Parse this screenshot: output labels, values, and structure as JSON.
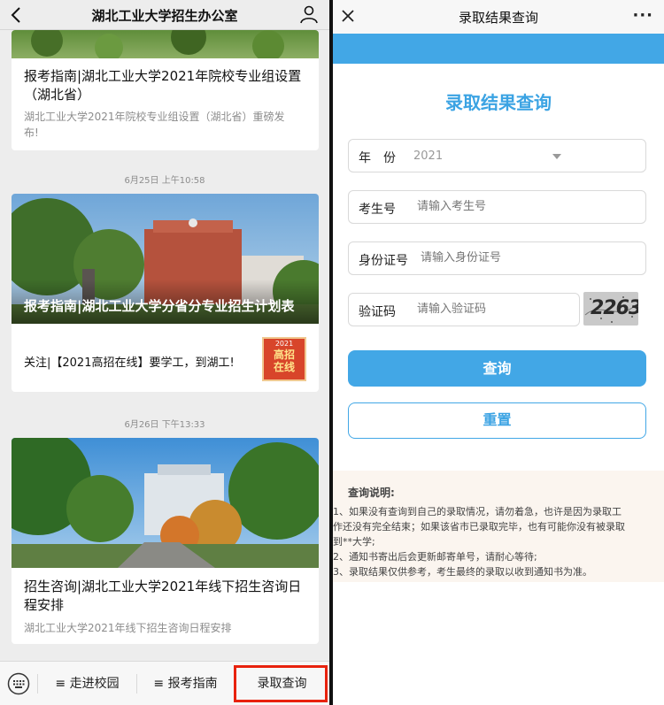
{
  "left": {
    "header": {
      "title": "湖北工业大学招生办公室",
      "back_icon": "chevron-left-icon",
      "user_icon": "user-icon"
    },
    "article1": {
      "title_line1": "报考指南|湖北工业大学2021年院校专业组设置",
      "title_line2": "（湖北省）",
      "desc_line1": "湖北工业大学2021年院校专业组设置（湖北省）重磅发",
      "desc_line2": "布!"
    },
    "timestamp1": "6月25日 上午10:58",
    "article2": {
      "hero_title": "报考指南|湖北工业大学分省分专业招生计划表",
      "sub_text": "关注|【2021高招在线】要学工，到湖工!",
      "thumb_line1": "2021",
      "thumb_line2": "高招",
      "thumb_line3": "在线"
    },
    "timestamp2": "6月26日 下午13:33",
    "article3": {
      "title_line1": "招生咨询|湖北工业大学2021年线下招生咨询日",
      "title_line2": "程安排",
      "desc": "湖北工业大学2021年线下招生咨询日程安排"
    },
    "footer": {
      "keyboard_icon": "keyboard-icon",
      "menu": [
        "≡ 走进校园",
        "≡ 报考指南",
        "录取查询"
      ]
    }
  },
  "right": {
    "header": {
      "title": "录取结果查询",
      "close_icon": "close-icon",
      "more": "···"
    },
    "form": {
      "title": "录取结果查询",
      "year_label": "年　份",
      "year_value": "2021",
      "exam_label": "考生号",
      "exam_placeholder": "请输入考生号",
      "id_label": "身份证号",
      "id_placeholder": "请输入身份证号",
      "code_label": "验证码",
      "code_placeholder": "请输入验证码",
      "captcha_text": "2263",
      "query_btn": "查询",
      "reset_btn": "重置"
    },
    "note": {
      "title": "查询说明:",
      "lines": [
        "1、如果没有查询到自己的录取情况，请勿着急，也许是因为录取工",
        "作还没有完全结束；如果该省市已录取完毕，也有可能你没有被录取",
        "到**大学;",
        "2、通知书寄出后会更新邮寄单号，请耐心等待;",
        "3、录取结果仅供参考，考生最终的录取以收到通知书为准。"
      ]
    }
  },
  "colors": {
    "accent": "#42a7e6",
    "highlight": "#e8220d"
  }
}
